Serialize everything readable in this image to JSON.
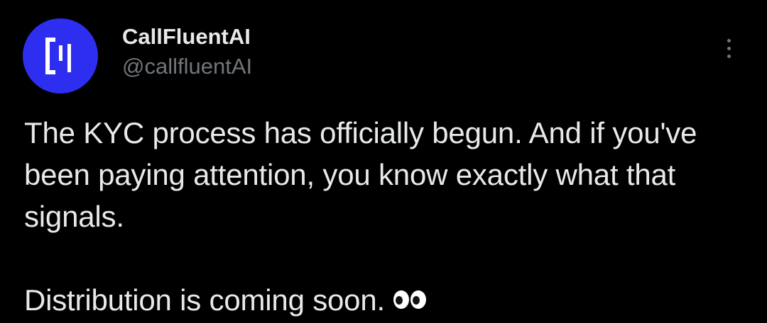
{
  "author": {
    "display_name": "CallFluentAI",
    "handle": "@callfluentAI",
    "avatar_icon": "callfluent-logo-icon",
    "avatar_color": "#2d2ef0"
  },
  "menu": {
    "icon": "more-vertical-icon"
  },
  "post": {
    "paragraph_1": "The KYC process has officially begun. And if you've been paying attention, you know exactly what that signals.",
    "paragraph_2": "Distribution is coming soon.",
    "emoji": "eyes-emoji"
  },
  "colors": {
    "background": "#000000",
    "primary_text": "#e7e9ea",
    "secondary_text": "#71767b"
  }
}
